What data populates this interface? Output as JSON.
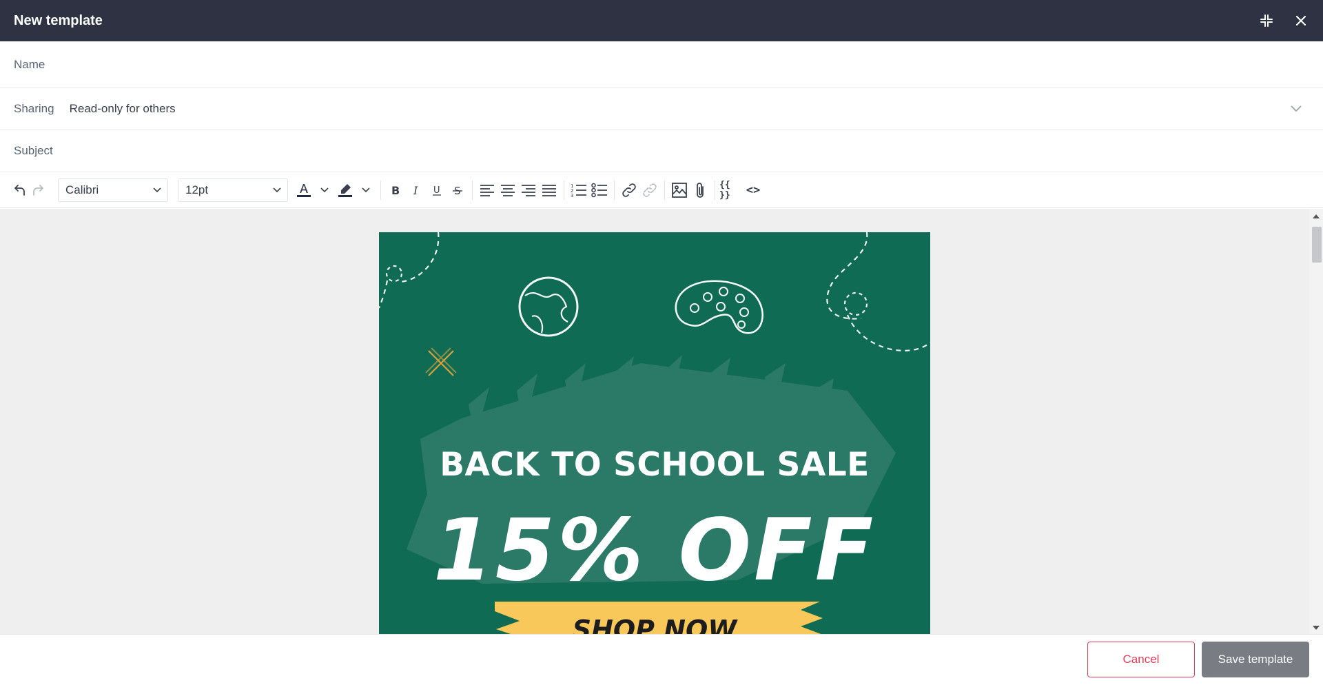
{
  "header": {
    "title": "New template",
    "minimize_icon": "collapse-icon",
    "close_icon": "close-icon"
  },
  "form": {
    "name_label": "Name",
    "sharing_label": "Sharing",
    "sharing_value": "Read-only for others",
    "subject_label": "Subject"
  },
  "toolbar": {
    "font_family": "Calibri",
    "font_size": "12pt",
    "buttons": [
      "undo",
      "redo",
      "text-color",
      "highlight-color",
      "bold",
      "italic",
      "underline",
      "strikethrough",
      "align-left",
      "align-center",
      "align-right",
      "justify",
      "numbered-list",
      "bulleted-list",
      "link",
      "unlink",
      "image",
      "attachment",
      "variables",
      "source-code"
    ],
    "variables_glyph": "{{ }}",
    "code_glyph": "<>"
  },
  "content": {
    "headline": "BACK TO SCHOOL SALE",
    "offer": "15% OFF",
    "cta": "SHOP NOW",
    "colors": {
      "banner_bg": "#106b54",
      "cta_bg": "#f8c95a",
      "brush": "#2f7c6a",
      "cross": "#d9a43a"
    }
  },
  "footer": {
    "cancel_label": "Cancel",
    "save_label": "Save template"
  }
}
